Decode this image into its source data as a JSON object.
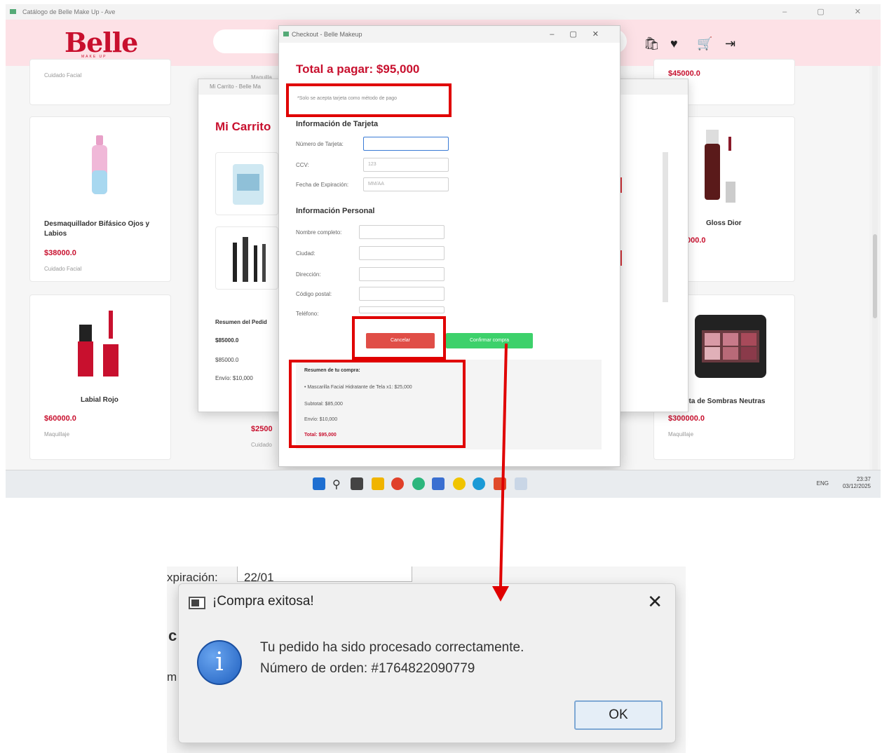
{
  "app": {
    "title": "Catálogo de Belle Make Up - Ave",
    "controls": "–  ▢  ✕"
  },
  "header": {
    "logo": "Belle",
    "logo_sub": "MAKE UP",
    "icons": [
      "bag-icon",
      "heart-icon",
      "cart-icon",
      "logout-icon"
    ]
  },
  "catalog": {
    "cards": [
      {
        "name": "",
        "price": "",
        "category": "Cuidado Facial"
      },
      {
        "name": "Desmaquillador Bifásico Ojos y Labios",
        "price": "$38000.0",
        "category": "Cuidado Facial"
      },
      {
        "name": "Labial Rojo",
        "price": "$60000.0",
        "category": "Maquillaje"
      },
      {
        "name": "",
        "price": "$45000.0",
        "category": ""
      },
      {
        "name": "Gloss Dior",
        "price": "000.0",
        "category": ""
      },
      {
        "name": "eta de Sombras Neutras",
        "price": "$300000.0",
        "category": "Maquillaje"
      }
    ],
    "partial_top_middle": "Maquilla",
    "partial_bottom_price": "$2500",
    "partial_bottom_cat": "Cuidado"
  },
  "cart": {
    "title": "Mi Carrito - Belle Ma",
    "heading": "Mi Carrito",
    "summary_heading": "Resumen del Pedid",
    "sum_line1": "$85000.0",
    "sum_line2": "$85000.0",
    "sum_line3": "Envío: $10,000"
  },
  "checkout": {
    "title": "Checkout - Belle Makeup",
    "total": "Total a pagar: $95,000",
    "note": "*Solo se acepta tarjeta como método de pago",
    "card_section": "Información de Tarjeta",
    "card_number_label": "Número de Tarjeta:",
    "ccv_label": "CCV:",
    "ccv_placeholder": "123",
    "expiry_label": "Fecha de Expiración:",
    "expiry_placeholder": "MM/AA",
    "personal_section": "Información Personal",
    "name_label": "Nombre completo:",
    "city_label": "Ciudad:",
    "address_label": "Dirección:",
    "zip_label": "Código postal:",
    "phone_label": "Teléfono:",
    "cancel_label": "Cancelar",
    "confirm_label": "Confirmar compra",
    "summary": {
      "heading": "Resumen de tu compra:",
      "item": "• Mascarilla Facial Hidratante de Tela x1: $25,000",
      "subtotal": "Subtotal: $85,000",
      "shipping": "Envío: $10,000",
      "total": "Total: $95,000"
    }
  },
  "taskbar": {
    "tray_lang": "ENG",
    "time": "23:37",
    "date": "03/12/2025"
  },
  "dialog_bg": {
    "fragment_label": "xpiración:",
    "fragment_value": "22/01",
    "fragment_c": "c",
    "fragment_m": "m"
  },
  "dialog": {
    "title": "¡Compra exitosa!",
    "close": "✕",
    "message_line1": "Tu pedido ha sido procesado correctamente.",
    "message_line2": "Número de orden: #1764822090779",
    "ok_label": "OK",
    "icon": "info-icon"
  },
  "colors": {
    "brand": "#c8102e",
    "header_bg": "#fde1e6",
    "highlight": "#e00000",
    "cancel": "#e04e47",
    "confirm": "#3dd16b"
  }
}
